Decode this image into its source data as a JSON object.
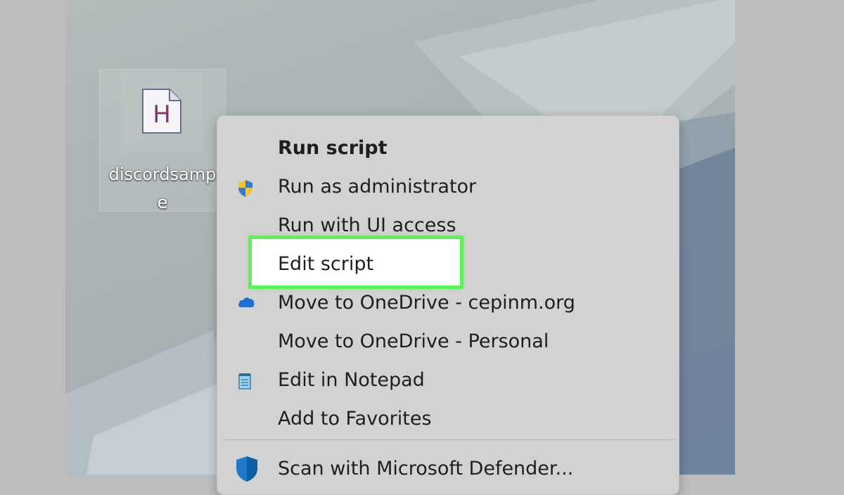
{
  "desktop": {
    "file_icon": {
      "glyph": "H",
      "name": "script-file-icon",
      "color": "#7a3a66"
    },
    "file_label_line1": "discordsamp",
    "file_label_line2": "e"
  },
  "menu": {
    "items": [
      {
        "label": "Run script",
        "icon": ""
      },
      {
        "label": "Run as administrator",
        "icon": "uac-shield-icon"
      },
      {
        "label": "Run with UI access",
        "icon": ""
      },
      {
        "label": "Edit script",
        "icon": "",
        "highlighted": true
      },
      {
        "label": "Move to OneDrive - cepinm.org",
        "icon": "onedrive-cloud-icon"
      },
      {
        "label": "Move to OneDrive - Personal",
        "icon": ""
      },
      {
        "label": "Edit in Notepad",
        "icon": "notepad-icon"
      },
      {
        "label": "Add to Favorites",
        "icon": ""
      },
      {
        "label": "Scan with Microsoft Defender...",
        "icon": "defender-shield-icon"
      }
    ]
  },
  "colors": {
    "highlight": "#5ef25a",
    "menu_bg": "#d2d2d2"
  }
}
